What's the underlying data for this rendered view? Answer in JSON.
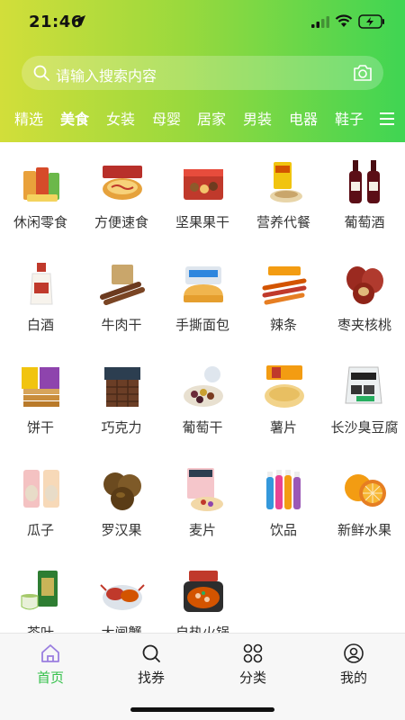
{
  "status_bar": {
    "time": "21:46"
  },
  "search": {
    "placeholder": "请输入搜索内容"
  },
  "tabs": [
    {
      "label": "精选"
    },
    {
      "label": "美食"
    },
    {
      "label": "女装"
    },
    {
      "label": "母婴"
    },
    {
      "label": "居家"
    },
    {
      "label": "男装"
    },
    {
      "label": "电器"
    },
    {
      "label": "鞋子"
    }
  ],
  "categories": [
    {
      "label": "休闲零食"
    },
    {
      "label": "方便速食"
    },
    {
      "label": "坚果果干"
    },
    {
      "label": "营养代餐"
    },
    {
      "label": "葡萄酒"
    },
    {
      "label": "白酒"
    },
    {
      "label": "牛肉干"
    },
    {
      "label": "手撕面包"
    },
    {
      "label": "辣条"
    },
    {
      "label": "枣夹核桃"
    },
    {
      "label": "饼干"
    },
    {
      "label": "巧克力"
    },
    {
      "label": "葡萄干"
    },
    {
      "label": "薯片"
    },
    {
      "label": "长沙臭豆腐"
    },
    {
      "label": "瓜子"
    },
    {
      "label": "罗汉果"
    },
    {
      "label": "麦片"
    },
    {
      "label": "饮品"
    },
    {
      "label": "新鲜水果"
    },
    {
      "label": "茶叶"
    },
    {
      "label": "大闸蟹"
    },
    {
      "label": "自热火锅"
    }
  ],
  "bottom_nav": [
    {
      "label": "首页",
      "icon": "home-icon"
    },
    {
      "label": "找券",
      "icon": "search-icon"
    },
    {
      "label": "分类",
      "icon": "grid-icon"
    },
    {
      "label": "我的",
      "icon": "user-icon"
    }
  ],
  "colors": {
    "gradient_start": "#d2de3a",
    "gradient_end": "#3fd553",
    "active_tab": "#35c14b"
  }
}
